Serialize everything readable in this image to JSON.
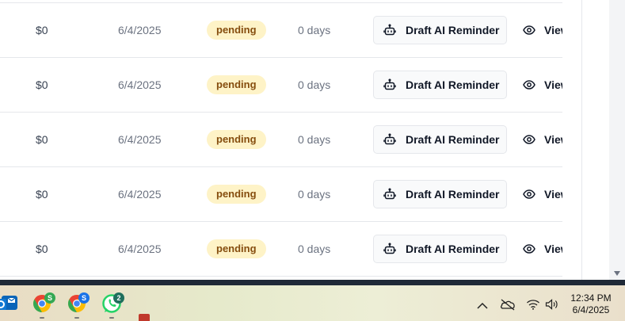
{
  "table": {
    "rows": [
      {
        "amount": "$0",
        "date": "6/4/2025",
        "status": "pending",
        "days": "0 days",
        "action_label": "Draft AI Reminder",
        "view_label": "View"
      },
      {
        "amount": "$0",
        "date": "6/4/2025",
        "status": "pending",
        "days": "0 days",
        "action_label": "Draft AI Reminder",
        "view_label": "View"
      },
      {
        "amount": "$0",
        "date": "6/4/2025",
        "status": "pending",
        "days": "0 days",
        "action_label": "Draft AI Reminder",
        "view_label": "View"
      },
      {
        "amount": "$0",
        "date": "6/4/2025",
        "status": "pending",
        "days": "0 days",
        "action_label": "Draft AI Reminder",
        "view_label": "View"
      },
      {
        "amount": "$0",
        "date": "6/4/2025",
        "status": "pending",
        "days": "0 days",
        "action_label": "Draft AI Reminder",
        "view_label": "View"
      }
    ]
  },
  "colors": {
    "badge_bg": "#fef3c7",
    "badge_text": "#854d0e",
    "row_border": "#e5e7eb",
    "button_bg": "#f9fafb"
  },
  "icons": {
    "action": "robot-icon",
    "view": "eye-icon"
  },
  "taskbar": {
    "apps": [
      {
        "name": "outlook-icon"
      },
      {
        "name": "chrome-icon",
        "badge": "S"
      },
      {
        "name": "chrome-icon",
        "badge": "S"
      },
      {
        "name": "whatsapp-icon",
        "badge": "2"
      }
    ],
    "tray": [
      "chevron-up-icon",
      "onedrive-icon",
      "wifi-icon",
      "speaker-icon"
    ],
    "time": "12:34 PM",
    "date": "6/4/2025"
  }
}
